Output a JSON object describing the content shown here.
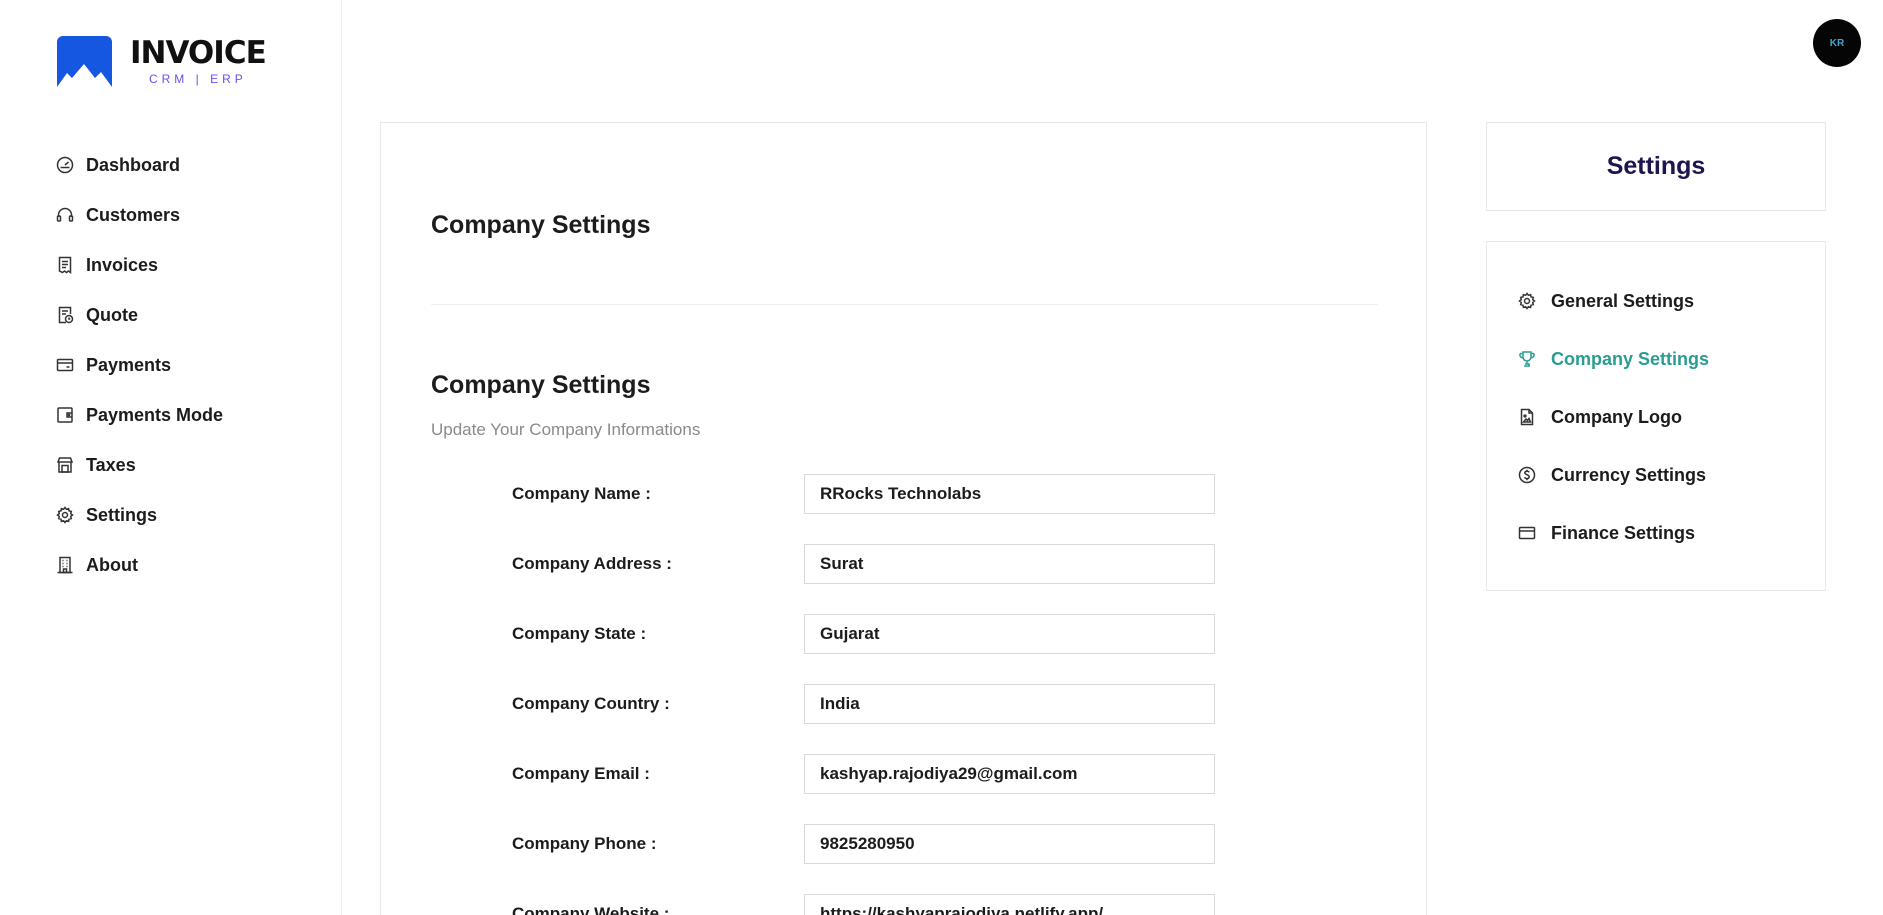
{
  "brand": {
    "title": "INVOICE",
    "subtitle": "CRM | ERP"
  },
  "user": {
    "initials": "KR"
  },
  "sidebar": {
    "items": [
      {
        "label": "Dashboard",
        "icon": "gauge-icon"
      },
      {
        "label": "Customers",
        "icon": "headset-icon"
      },
      {
        "label": "Invoices",
        "icon": "receipt-icon"
      },
      {
        "label": "Quote",
        "icon": "file-clock-icon"
      },
      {
        "label": "Payments",
        "icon": "credit-card-icon"
      },
      {
        "label": "Payments Mode",
        "icon": "wallet-icon"
      },
      {
        "label": "Taxes",
        "icon": "shop-icon"
      },
      {
        "label": "Settings",
        "icon": "gear-icon"
      },
      {
        "label": "About",
        "icon": "building-icon"
      }
    ]
  },
  "main": {
    "page_title": "Company Settings",
    "section_title": "Company Settings",
    "section_subtitle": "Update Your Company Informations",
    "fields": [
      {
        "label": "Company Name",
        "value": "RRocks Technolabs"
      },
      {
        "label": "Company Address",
        "value": "Surat"
      },
      {
        "label": "Company State",
        "value": "Gujarat"
      },
      {
        "label": "Company Country",
        "value": "India"
      },
      {
        "label": "Company Email",
        "value": "kashyap.rajodiya29@gmail.com"
      },
      {
        "label": "Company Phone",
        "value": "9825280950"
      },
      {
        "label": "Company Website",
        "value": "https://kashyaprajodiya.netlify.app/"
      }
    ]
  },
  "settings_panel": {
    "title": "Settings",
    "items": [
      {
        "label": "General Settings",
        "icon": "gear-icon",
        "active": false
      },
      {
        "label": "Company Settings",
        "icon": "trophy-icon",
        "active": true
      },
      {
        "label": "Company Logo",
        "icon": "file-image-icon",
        "active": false
      },
      {
        "label": "Currency Settings",
        "icon": "dollar-circle-icon",
        "active": false
      },
      {
        "label": "Finance Settings",
        "icon": "credit-card-icon",
        "active": false
      }
    ]
  },
  "colors": {
    "accent": "#2a9d92",
    "brand": "#1557e0",
    "brand_sub": "#6f4cf0",
    "settings_title": "#1f1450"
  }
}
